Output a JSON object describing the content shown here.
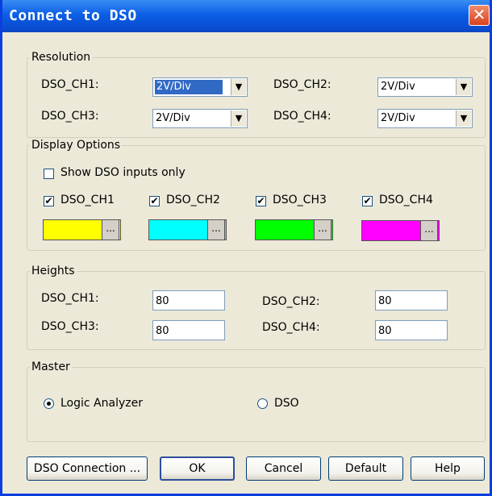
{
  "window": {
    "title": "Connect to DSO",
    "close_glyph": "✕"
  },
  "resolution": {
    "legend": "Resolution",
    "rows": [
      {
        "label": "DSO_CH1:",
        "value": "2V/Div"
      },
      {
        "label": "DSO_CH2:",
        "value": "2V/Div"
      },
      {
        "label": "DSO_CH3:",
        "value": "2V/Div"
      },
      {
        "label": "DSO_CH4:",
        "value": "2V/Div"
      }
    ]
  },
  "display": {
    "legend": "Display Options",
    "show_inputs_only": {
      "label": "Show DSO inputs only",
      "checked": false
    },
    "channels": [
      {
        "label": "DSO_CH1",
        "checked": true,
        "color": "#ffff00"
      },
      {
        "label": "DSO_CH2",
        "checked": true,
        "color": "#00ffff"
      },
      {
        "label": "DSO_CH3",
        "checked": true,
        "color": "#00ff00"
      },
      {
        "label": "DSO_CH4",
        "checked": true,
        "color": "#ff00ff"
      }
    ],
    "color_button_text": "..."
  },
  "heights": {
    "legend": "Heights",
    "rows": [
      {
        "label": "DSO_CH1:",
        "value": "80"
      },
      {
        "label": "DSO_CH2:",
        "value": "80"
      },
      {
        "label": "DSO_CH3:",
        "value": "80"
      },
      {
        "label": "DSO_CH4:",
        "value": "80"
      }
    ]
  },
  "master": {
    "legend": "Master",
    "options": [
      {
        "label": "Logic Analyzer",
        "selected": true
      },
      {
        "label": "DSO",
        "selected": false
      }
    ]
  },
  "buttons": {
    "dso_connection": "DSO Connection ...",
    "ok": "OK",
    "cancel": "Cancel",
    "default": "Default",
    "help": "Help"
  },
  "check_glyph": "✔",
  "arrow_glyph": "▼"
}
